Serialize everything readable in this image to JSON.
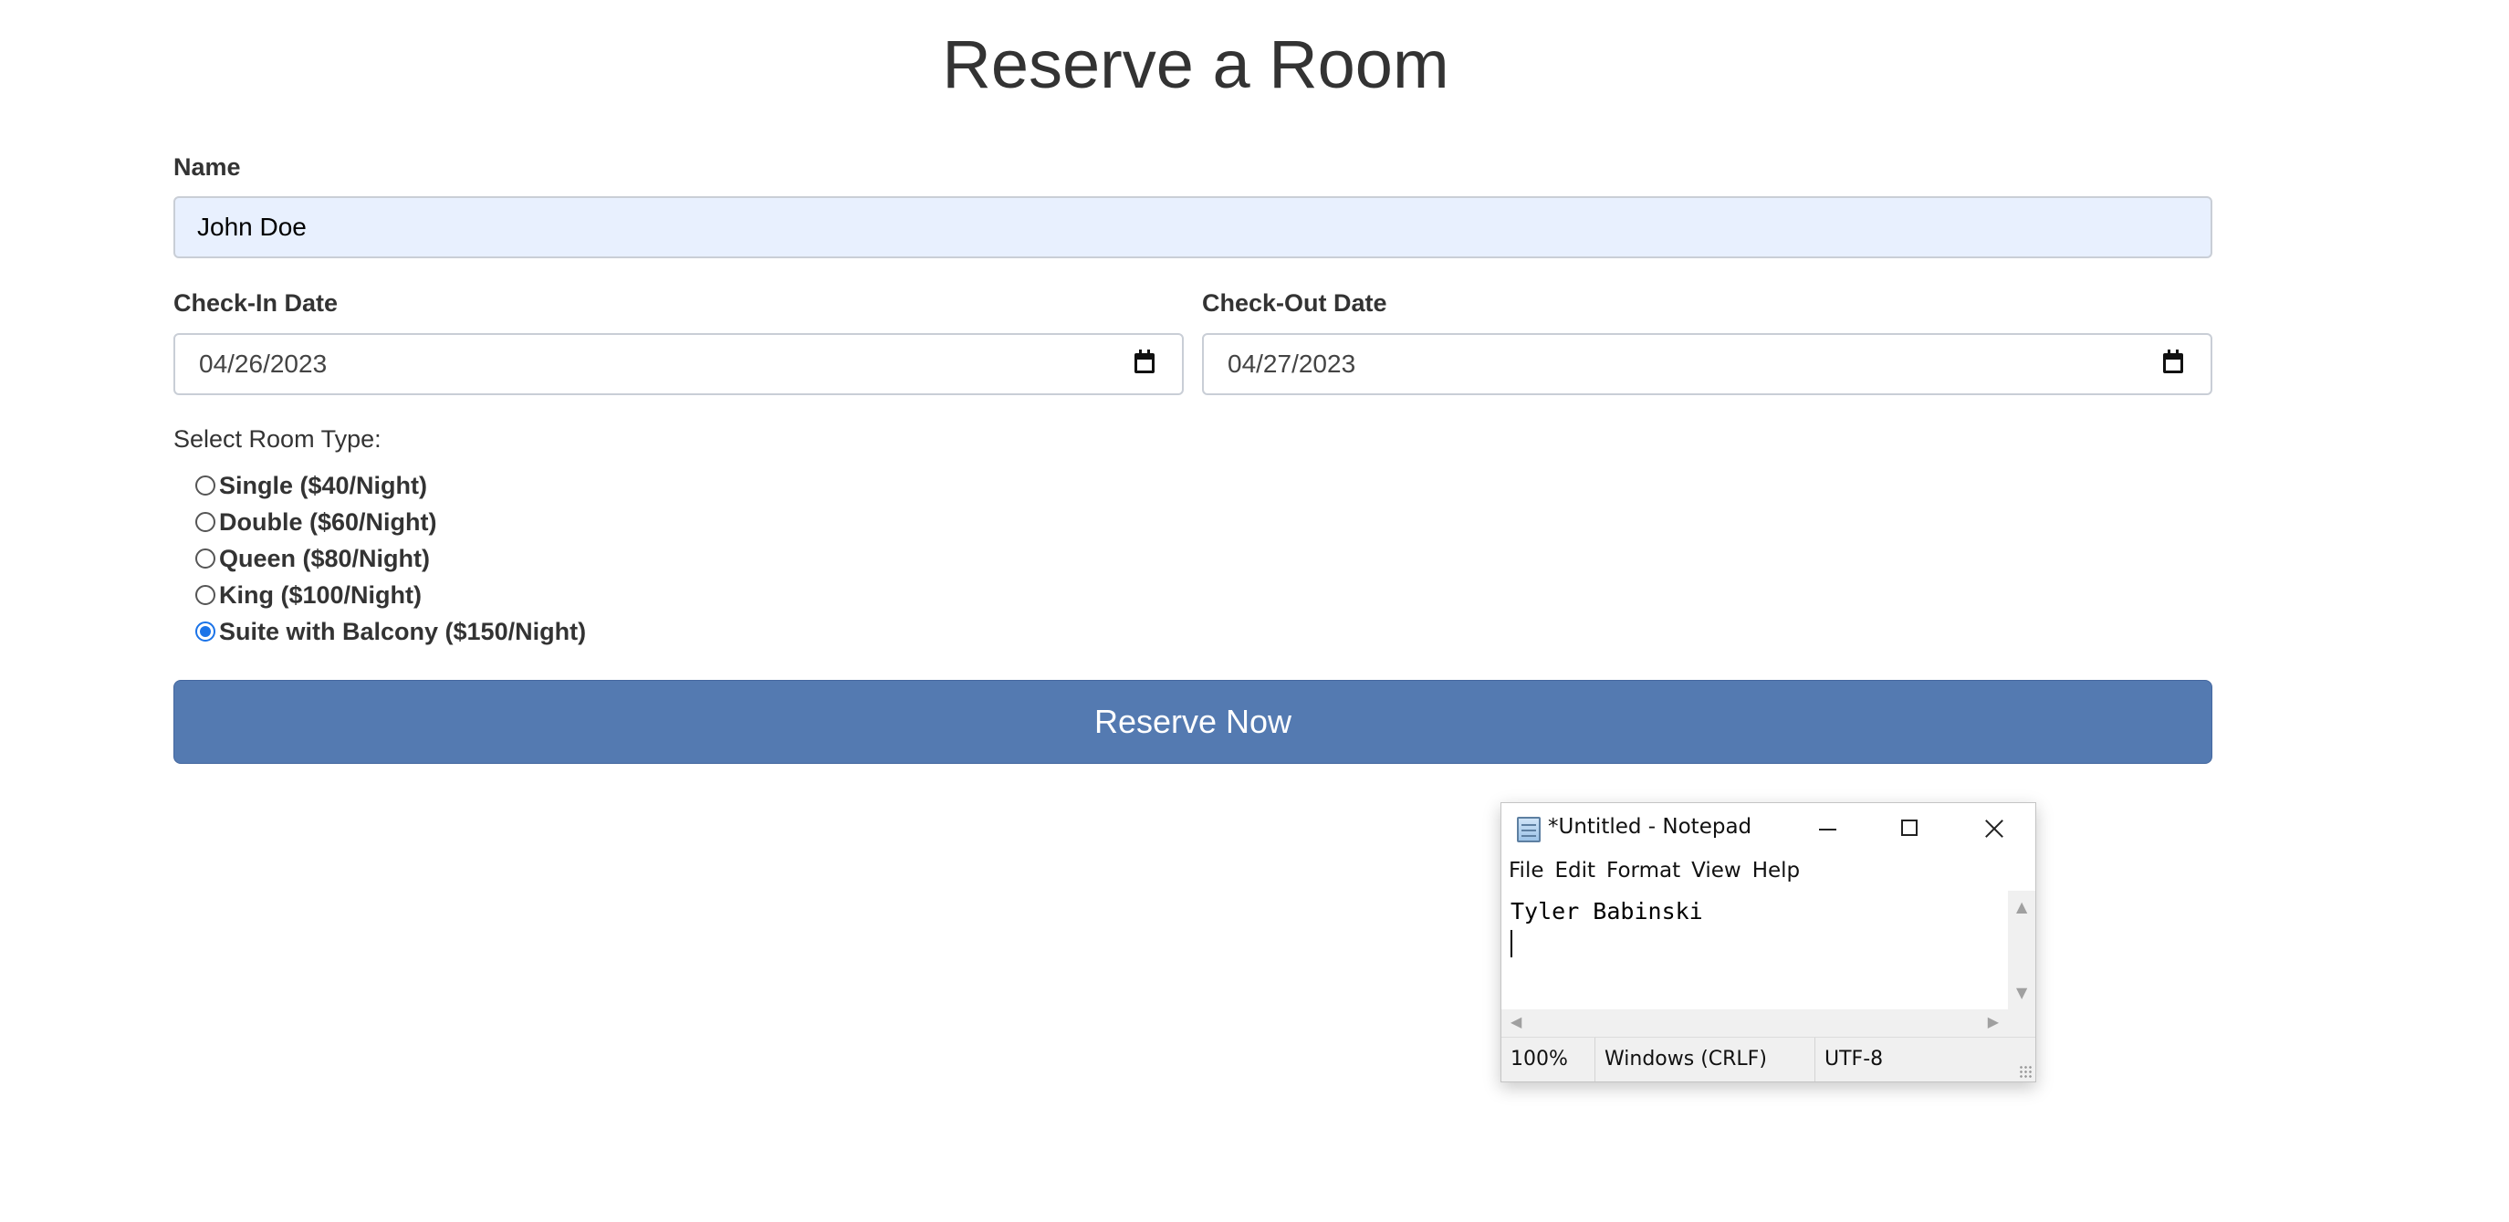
{
  "form": {
    "title": "Reserve a Room",
    "name_label": "Name",
    "name_value": "John Doe",
    "checkin_label": "Check-In Date",
    "checkin_value": "04/26/2023",
    "checkout_label": "Check-Out Date",
    "checkout_value": "04/27/2023",
    "room_prompt": "Select Room Type:",
    "room_options": [
      {
        "label": "Single ($40/Night)",
        "selected": false
      },
      {
        "label": "Double ($60/Night)",
        "selected": false
      },
      {
        "label": "Queen ($80/Night)",
        "selected": false
      },
      {
        "label": "King ($100/Night)",
        "selected": false
      },
      {
        "label": "Suite with Balcony ($150/Night)",
        "selected": true
      }
    ],
    "submit_label": "Reserve Now",
    "submit_color": "#547ab1",
    "name_field_bg": "#e8f0fe",
    "radio_accent": "#1a73e8"
  },
  "notepad": {
    "title": "*Untitled - Notepad",
    "menu": [
      "File",
      "Edit",
      "Format",
      "View",
      "Help"
    ],
    "content_lines": [
      "Tyler Babinski",
      ""
    ],
    "status_zoom": "100%",
    "status_eol": "Windows (CRLF)",
    "status_encoding": "UTF-8"
  }
}
